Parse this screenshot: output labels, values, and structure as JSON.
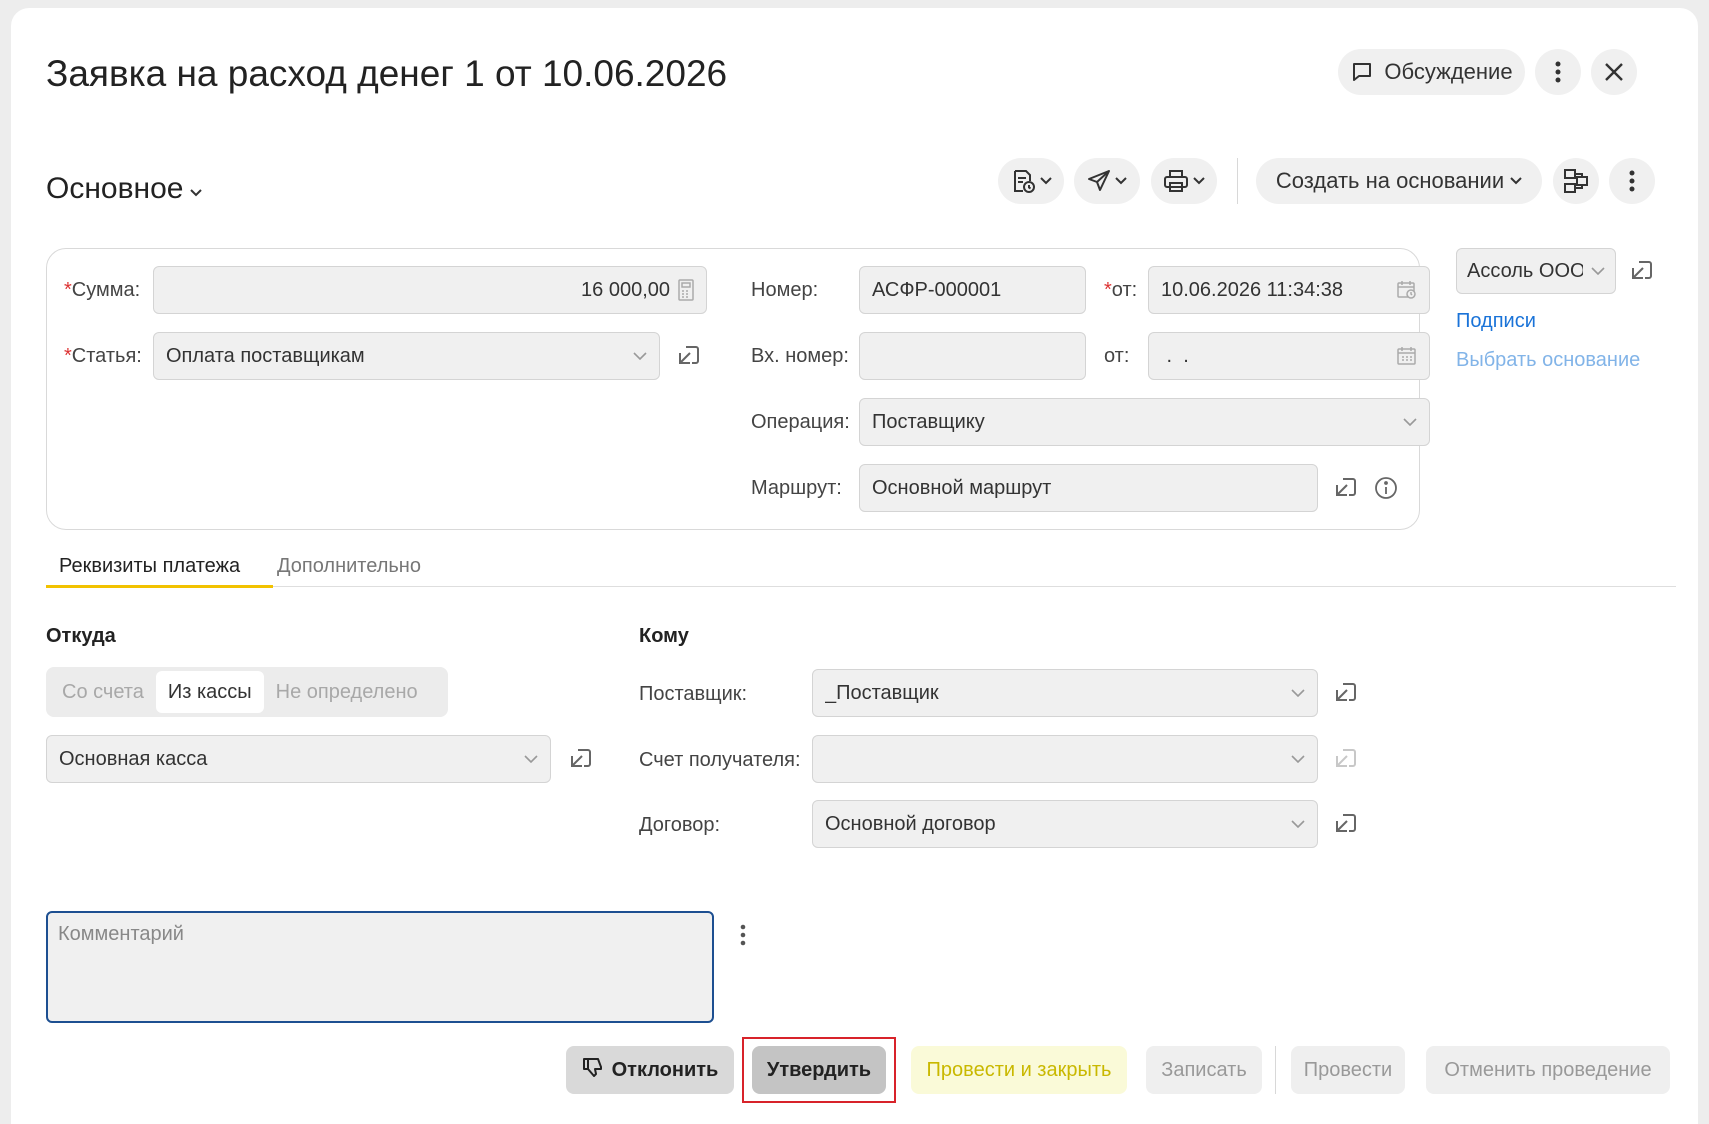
{
  "header": {
    "title": "Заявка на расход денег 1 от 10.06.2026",
    "discussion_label": "Обсуждение"
  },
  "toolbar": {
    "section_label": "Основное",
    "create_based_label": "Создать на основании"
  },
  "form": {
    "sum_label": "Сумма:",
    "sum_value": "16 000,00",
    "article_label": "Статья:",
    "article_value": "Оплата поставщикам",
    "number_label": "Номер:",
    "number_value": "АСФР-000001",
    "from_label": "от:",
    "from_value": "10.06.2026 11:34:38",
    "incoming_label": "Вх. номер:",
    "incoming_value": "",
    "incoming_from_label": "от:",
    "incoming_from_value": " .  .",
    "operation_label": "Операция:",
    "operation_value": "Поставщику",
    "route_label": "Маршрут:",
    "route_value": "Основной маршрут",
    "required_mark": "*"
  },
  "side": {
    "org_value": "Ассоль ООО",
    "signatures_link": "Подписи",
    "choose_basis_link": "Выбрать основание"
  },
  "tabs": [
    {
      "label": "Реквизиты платежа"
    },
    {
      "label": "Дополнительно"
    }
  ],
  "from_section": {
    "title": "Откуда",
    "segments": [
      "Со счета",
      "Из кассы",
      "Не определено"
    ],
    "selected_segment": "Из кассы",
    "cash_value": "Основная касса"
  },
  "to_section": {
    "title": "Кому",
    "supplier_label": "Поставщик:",
    "supplier_value": "_Поставщик",
    "account_label": "Счет получателя:",
    "account_value": "",
    "contract_label": "Договор:",
    "contract_value": "Основной договор"
  },
  "comment": {
    "placeholder": "Комментарий"
  },
  "footer": {
    "reject_label": "Отклонить",
    "approve_label": "Утвердить",
    "post_close_label": "Провести и закрыть",
    "save_label": "Записать",
    "post_label": "Провести",
    "cancel_post_label": "Отменить проведение"
  },
  "colors": {
    "accent_yellow": "#f2c200",
    "link_blue": "#1a73d8",
    "required_red": "#d33333",
    "focus_blue": "#1d4f91",
    "highlight_red": "#d8232a"
  }
}
